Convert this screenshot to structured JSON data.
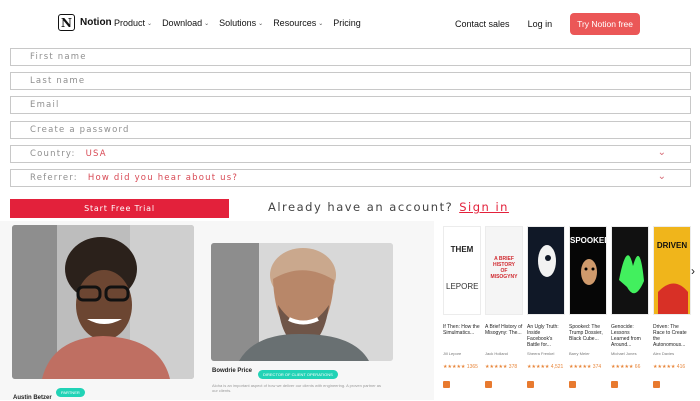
{
  "header": {
    "brand": "Notion",
    "logo_glyph": "N",
    "nav": [
      "Product",
      "Download",
      "Solutions",
      "Resources",
      "Pricing"
    ],
    "contact": "Contact sales",
    "login": "Log in",
    "cta": "Try Notion free"
  },
  "form": {
    "first_name": "First name",
    "last_name": "Last name",
    "email": "Email",
    "password": "Create a password",
    "country_label": "Country:",
    "country_value": "USA",
    "referrer_label": "Referrer:",
    "referrer_value": "How did you hear about us?",
    "start_trial": "Start Free Trial",
    "already": "Already have an account?",
    "signin": "Sign in"
  },
  "people": [
    {
      "name": "Austin Betzer",
      "tag": "PARTNER"
    },
    {
      "name": "Bowdrie Price",
      "tag": "DIRECTOR OF CLIENT OPERATIONS",
      "caption": "Aloha is an important aspect of how we deliver our clients with engineering. A proven partner as our clients."
    }
  ],
  "books": [
    {
      "cover": "THEM",
      "caption": "If Then: How the Simulmatics...",
      "author": "Jill Lepore",
      "rating": "★★★★★ 1365"
    },
    {
      "cover": "A BRIEF HISTORY OF MISOGYNY",
      "caption": "A Brief History of Misogyny: The...",
      "author": "Jack Holland",
      "rating": "★★★★★ 378"
    },
    {
      "cover": "",
      "caption": "An Ugly Truth: Inside Facebook's Battle for...",
      "author": "Sheera Frenkel",
      "rating": "★★★★★ 4,521"
    },
    {
      "cover": "SPOOKED",
      "caption": "Spooked: The Trump Dossier, Black Cube...",
      "author": "Barry Meier",
      "rating": "★★★★★ 374"
    },
    {
      "cover": "",
      "caption": "Genocide: Lessons Learned from Around...",
      "author": "Michael Jones",
      "rating": "★★★★★ 66"
    },
    {
      "cover": "DRIVEN",
      "caption": "Driven: The Race to Create the Autonomous...",
      "author": "Alex Davies",
      "rating": "★★★★★ 416"
    }
  ],
  "colors": {
    "accent": "#e3213b",
    "notion_cta": "#eb5757",
    "tag": "#22d3b6"
  }
}
